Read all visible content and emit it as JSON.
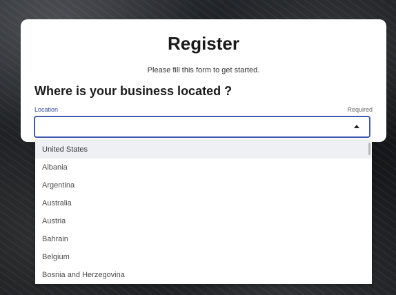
{
  "form": {
    "title": "Register",
    "subtitle": "Please fill this form to get started.",
    "question": "Where is your business located ?",
    "field_label": "Location",
    "required_label": "Required",
    "location_value": ""
  },
  "dropdown": {
    "options": [
      "United States",
      "Albania",
      "Argentina",
      "Australia",
      "Austria",
      "Bahrain",
      "Belgium",
      "Bosnia and Herzegovina"
    ],
    "highlighted_index": 0
  },
  "colors": {
    "accent": "#3f5ab0",
    "highlight": "#eef0f4"
  }
}
